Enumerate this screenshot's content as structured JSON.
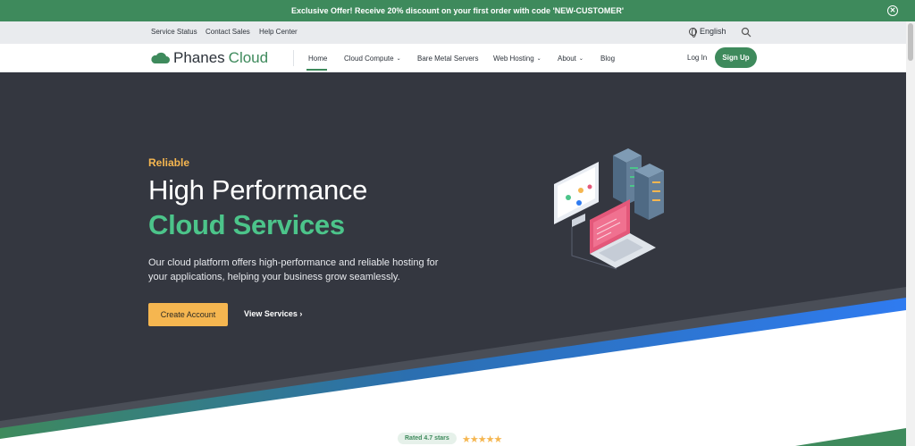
{
  "promo": {
    "text": "Exclusive Offer! Receive 20% discount on your first order with code 'NEW-CUSTOMER'",
    "close_icon": "close-circle-icon"
  },
  "utility": {
    "links": [
      "Service Status",
      "Contact Sales",
      "Help Center"
    ],
    "language": "English",
    "language_icon": "globe-icon",
    "search_icon": "search-icon"
  },
  "nav": {
    "logo_left": "Phanes",
    "logo_right": "Cloud",
    "items": [
      {
        "label": "Home",
        "dropdown": false,
        "active": true
      },
      {
        "label": "Cloud Compute",
        "dropdown": true
      },
      {
        "label": "Bare Metal Servers",
        "dropdown": false
      },
      {
        "label": "Web Hosting",
        "dropdown": true
      },
      {
        "label": "About",
        "dropdown": true
      },
      {
        "label": "Blog",
        "dropdown": false
      }
    ],
    "login": "Log In",
    "signup": "Sign Up"
  },
  "hero": {
    "eyebrow": "Reliable",
    "title_line1": "High Performance",
    "title_line2": "Cloud Services",
    "lead": "Our cloud platform offers high-performance and reliable hosting for your applications, helping your business grow seamlessly.",
    "cta_primary": "Create Account",
    "cta_secondary": "View Services ›"
  },
  "rating": {
    "label": "Rated 4.7 stars",
    "stars": "★★★★★"
  },
  "colors": {
    "brand_green": "#3e8a5c",
    "accent_orange": "#f5b650",
    "hero_bg": "#343740",
    "hero_green_text": "#4cc48a",
    "stripe_blue": "#2f7bf0"
  }
}
